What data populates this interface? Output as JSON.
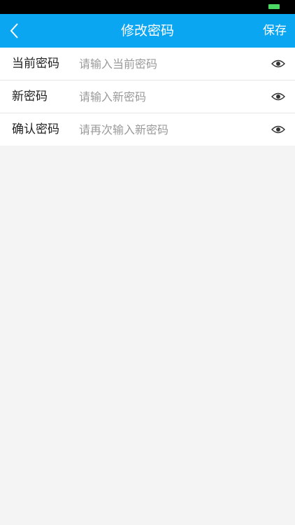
{
  "nav": {
    "title": "修改密码",
    "save_label": "保存"
  },
  "form": {
    "rows": [
      {
        "label": "当前密码",
        "placeholder": "请输入当前密码",
        "value": ""
      },
      {
        "label": "新密码",
        "placeholder": "请输入新密码",
        "value": ""
      },
      {
        "label": "确认密码",
        "placeholder": "请再次输入新密码",
        "value": ""
      }
    ]
  },
  "colors": {
    "nav_background": "#0aa6f2",
    "page_background": "#f4f4f4",
    "battery": "#4cd964"
  },
  "icons": {
    "back": "chevron-left-icon",
    "toggle_visibility": "eye-icon"
  }
}
